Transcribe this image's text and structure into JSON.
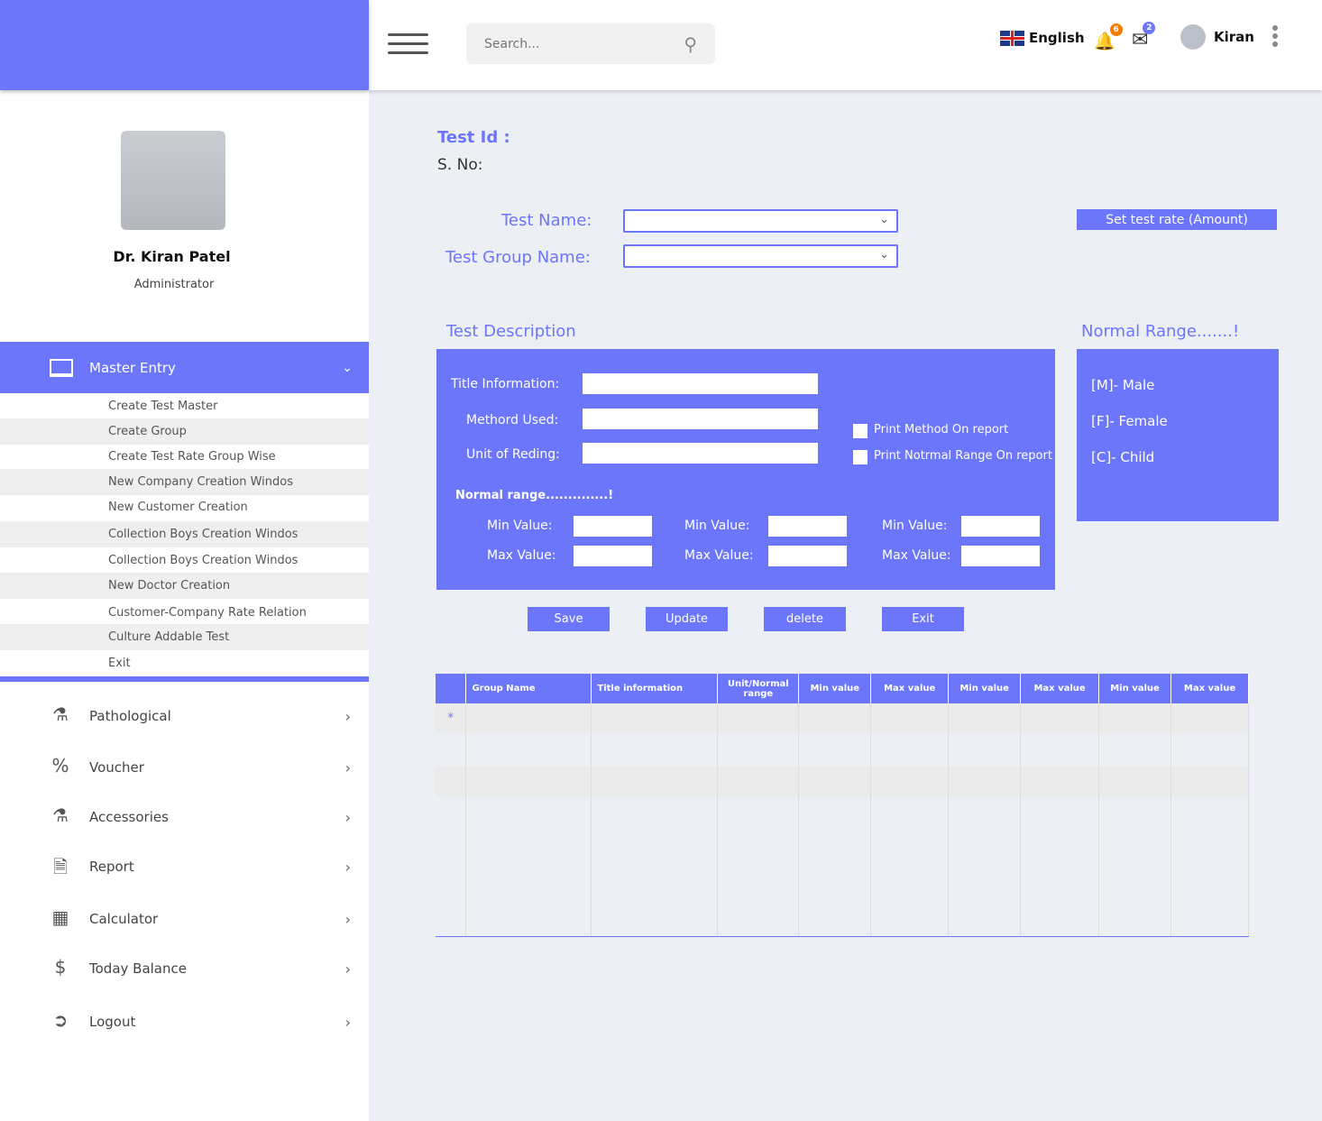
{
  "header": {
    "search_placeholder": "Search...",
    "language": "English",
    "notifications": "6",
    "messages": "2",
    "user": "Kiran"
  },
  "profile": {
    "name": "Dr. Kiran Patel",
    "role": "Administrator"
  },
  "sidebar": {
    "master_entry": "Master Entry",
    "sub_items": [
      "Create Test Master",
      "Create Group",
      "Create Test Rate Group Wise",
      "New Company Creation Windos",
      "New Customer Creation",
      "Collection Boys Creation Windos",
      "Collection Boys Creation Windos",
      "New Doctor Creation",
      "Customer-Company Rate Relation",
      "Culture Addable Test",
      "Exit"
    ],
    "items": [
      {
        "label": "Pathological",
        "icon": "microscope-icon"
      },
      {
        "label": "Voucher",
        "icon": "voucher-icon"
      },
      {
        "label": "Accessories",
        "icon": "lab-bottles-icon"
      },
      {
        "label": "Report",
        "icon": "report-icon"
      },
      {
        "label": "Calculator",
        "icon": "calculator-icon"
      },
      {
        "label": "Today Balance",
        "icon": "balance-icon"
      },
      {
        "label": "Logout",
        "icon": "logout-icon"
      }
    ]
  },
  "form": {
    "test_id": "Test Id :",
    "sno": "S. No:",
    "test_name": "Test  Name:",
    "group_name": "Test  Group Name:",
    "set_rate": "Set test rate (Amount)",
    "desc_title": "Test Description",
    "title_info": "Title Information:",
    "method": "Methord Used:",
    "unit": "Unit of Reding:",
    "print_method": "Print Method On report",
    "print_range": "Print Notrmal Range  On report",
    "normal_range": "Normal range..............!",
    "min": "Min Value:",
    "max": "Max Value:",
    "range_title": "Normal Range.......!",
    "male": "[M]- Male",
    "female": "[F]- Female",
    "child": "[C]- Child",
    "buttons": [
      "Save",
      "Update",
      "delete",
      "Exit"
    ]
  },
  "table": {
    "columns": [
      "",
      "Group Name",
      "Title information",
      "Unit/Normal range",
      "Min value",
      "Max value",
      "Min value",
      "Max value",
      "Min value",
      "Max value"
    ],
    "new_row_marker": "*"
  },
  "colors": {
    "accent": "#6b76fb"
  }
}
